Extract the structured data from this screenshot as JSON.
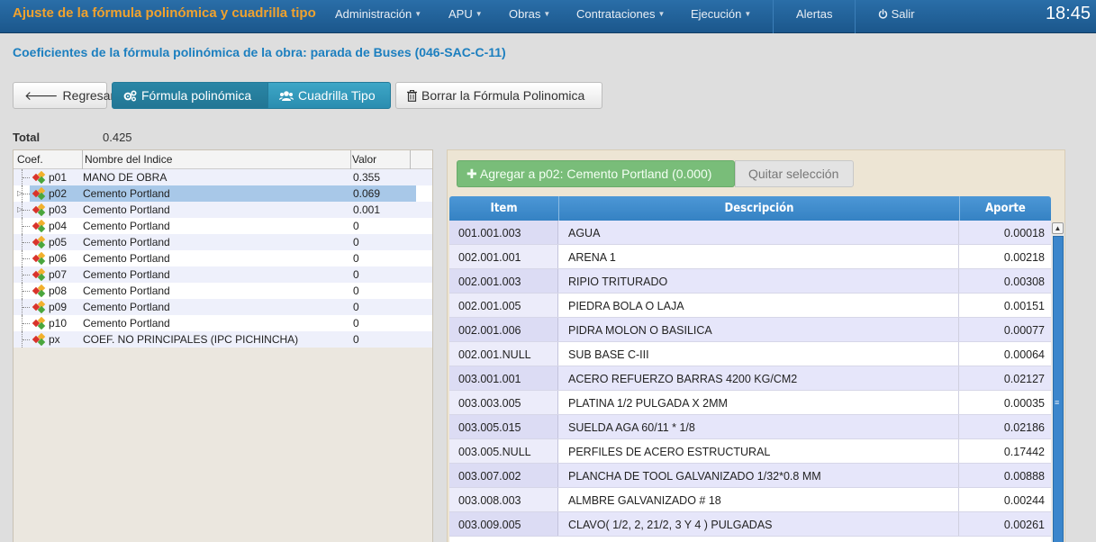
{
  "app": {
    "title": "Ajuste de la fórmula polinómica y cuadrilla tipo",
    "clock": "18:45"
  },
  "nav": {
    "items": [
      "Administración",
      "APU",
      "Obras",
      "Contrataciones",
      "Ejecución"
    ],
    "alerts": "Alertas",
    "logout": "Salir"
  },
  "page": {
    "title": "Coeficientes de la fórmula polinómica de la obra: parada de Buses (046-SAC-C-11)"
  },
  "toolbar": {
    "back": "Regresar",
    "formula": "Fórmula polinómica",
    "cuadrilla": "Cuadrilla Tipo",
    "delete": "Borrar la Fórmula Polinomica"
  },
  "total": {
    "label": "Total",
    "value": "0.425"
  },
  "tree": {
    "headers": {
      "coef": "Coef.",
      "name": "Nombre del Indice",
      "value": "Valor"
    },
    "rows": [
      {
        "code": "p01",
        "name": "MANO DE OBRA",
        "value": "0.355"
      },
      {
        "code": "p02",
        "name": "Cemento Portland",
        "value": "0.069"
      },
      {
        "code": "p03",
        "name": "Cemento Portland",
        "value": "0.001"
      },
      {
        "code": "p04",
        "name": "Cemento Portland",
        "value": "0"
      },
      {
        "code": "p05",
        "name": "Cemento Portland",
        "value": "0"
      },
      {
        "code": "p06",
        "name": "Cemento Portland",
        "value": "0"
      },
      {
        "code": "p07",
        "name": "Cemento Portland",
        "value": "0"
      },
      {
        "code": "p08",
        "name": "Cemento Portland",
        "value": "0"
      },
      {
        "code": "p09",
        "name": "Cemento Portland",
        "value": "0"
      },
      {
        "code": "p10",
        "name": "Cemento Portland",
        "value": "0"
      },
      {
        "code": "px",
        "name": "COEF. NO PRINCIPALES (IPC PICHINCHA)",
        "value": "0"
      }
    ]
  },
  "actions": {
    "add": "Agregar a p02: Cemento Portland (0.000)",
    "clear": "Quitar selección"
  },
  "grid": {
    "headers": {
      "item": "Item",
      "desc": "Descripción",
      "aporte": "Aporte"
    },
    "rows": [
      {
        "item": "001.001.003",
        "desc": "AGUA",
        "aporte": "0.00018"
      },
      {
        "item": "002.001.001",
        "desc": "ARENA 1",
        "aporte": "0.00218"
      },
      {
        "item": "002.001.003",
        "desc": "RIPIO TRITURADO",
        "aporte": "0.00308"
      },
      {
        "item": "002.001.005",
        "desc": "PIEDRA BOLA O LAJA",
        "aporte": "0.00151"
      },
      {
        "item": "002.001.006",
        "desc": "PIDRA MOLON O BASILICA",
        "aporte": "0.00077"
      },
      {
        "item": "002.001.NULL",
        "desc": "SUB BASE C-III",
        "aporte": "0.00064"
      },
      {
        "item": "003.001.001",
        "desc": "ACERO REFUERZO BARRAS 4200 KG/CM2",
        "aporte": "0.02127"
      },
      {
        "item": "003.003.005",
        "desc": "PLATINA 1/2 PULGADA X 2MM",
        "aporte": "0.00035"
      },
      {
        "item": "003.005.015",
        "desc": "SUELDA AGA 60/11 * 1/8",
        "aporte": "0.02186"
      },
      {
        "item": "003.005.NULL",
        "desc": "PERFILES DE ACERO ESTRUCTURAL",
        "aporte": "0.17442"
      },
      {
        "item": "003.007.002",
        "desc": "PLANCHA DE TOOL GALVANIZADO 1/32*0.8 MM",
        "aporte": "0.00888"
      },
      {
        "item": "003.008.003",
        "desc": "ALMBRE GALVANIZADO # 18",
        "aporte": "0.00244"
      },
      {
        "item": "003.009.005",
        "desc": "CLAVO( 1/2, 2, 21/2, 3 Y 4 ) PULGADAS",
        "aporte": "0.00261"
      }
    ]
  }
}
